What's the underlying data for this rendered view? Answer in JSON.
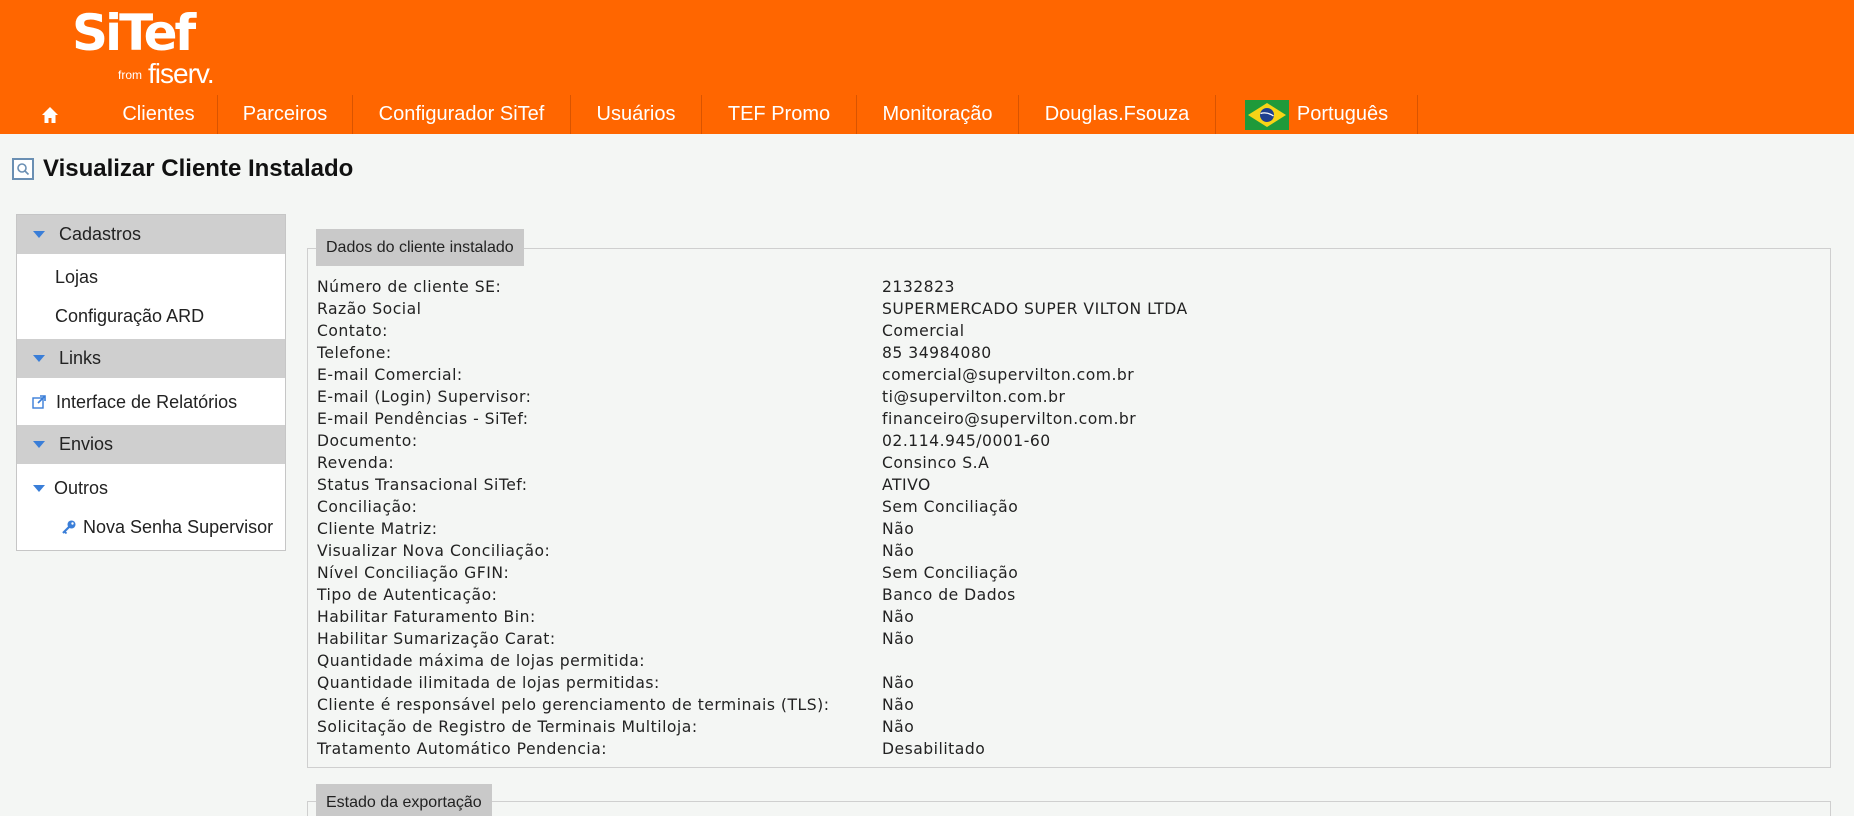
{
  "brand": {
    "logo": "SiTef",
    "from": "from",
    "company": "fiserv.",
    "header_color": "#ff6600"
  },
  "nav": {
    "home_icon": "home-icon",
    "items": [
      "Clientes",
      "Parceiros",
      "Configurador SiTef",
      "Usuários",
      "TEF Promo",
      "Monitoração",
      "Douglas.Fsouza"
    ],
    "language": "Português",
    "flag_icon": "brazil-flag-icon"
  },
  "page": {
    "title": "Visualizar Cliente Instalado",
    "title_icon": "search-icon"
  },
  "sidebar": {
    "sections": [
      {
        "label": "Cadastros",
        "items": [
          "Lojas",
          "Configuração ARD"
        ]
      },
      {
        "label": "Links",
        "items": [
          "Interface de Relatórios"
        ]
      },
      {
        "label": "Envios",
        "items": [
          "Outros",
          "Nova Senha Supervisor"
        ]
      }
    ],
    "icons": {
      "external_link": "external-link-icon",
      "key": "key-icon",
      "caret": "caret-down-icon"
    },
    "accent_color": "#3a7ed8"
  },
  "details": {
    "legend": "Dados do cliente instalado",
    "rows": [
      {
        "label": "Número de cliente SE:",
        "value": "2132823"
      },
      {
        "label": "Razão Social",
        "value": "SUPERMERCADO SUPER VILTON LTDA"
      },
      {
        "label": "Contato:",
        "value": "Comercial"
      },
      {
        "label": "Telefone:",
        "value": "85 34984080"
      },
      {
        "label": "E-mail Comercial:",
        "value": "comercial@supervilton.com.br"
      },
      {
        "label": "E-mail (Login) Supervisor:",
        "value": "ti@supervilton.com.br"
      },
      {
        "label": "E-mail Pendências - SiTef:",
        "value": "financeiro@supervilton.com.br"
      },
      {
        "label": "Documento:",
        "value": "02.114.945/0001-60"
      },
      {
        "label": "Revenda:",
        "value": "Consinco S.A"
      },
      {
        "label": "Status Transacional SiTef:",
        "value": "ATIVO"
      },
      {
        "label": "Conciliação:",
        "value": "Sem Conciliação"
      },
      {
        "label": "Cliente Matriz:",
        "value": "Não"
      },
      {
        "label": "Visualizar Nova Conciliação:",
        "value": "Não"
      },
      {
        "label": "Nível Conciliação GFIN:",
        "value": "Sem Conciliação"
      },
      {
        "label": "Tipo de Autenticação:",
        "value": "Banco de Dados"
      },
      {
        "label": "Habilitar Faturamento Bin:",
        "value": "Não"
      },
      {
        "label": "Habilitar Sumarização Carat:",
        "value": "Não"
      },
      {
        "label": "Quantidade máxima de lojas permitida:",
        "value": ""
      },
      {
        "label": "Quantidade ilimitada de lojas permitidas:",
        "value": "Não"
      },
      {
        "label": "Cliente é responsável pelo gerenciamento de terminais (TLS):",
        "value": "Não"
      },
      {
        "label": "Solicitação de Registro de Terminais Multiloja:",
        "value": "Não"
      },
      {
        "label": "Tratamento Automático Pendencia:",
        "value": "Desabilitado"
      }
    ]
  },
  "export": {
    "legend": "Estado da exportação"
  }
}
